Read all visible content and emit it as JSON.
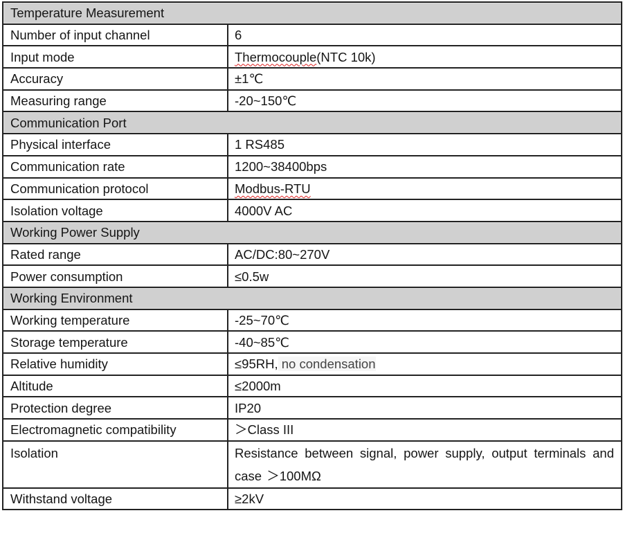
{
  "table": {
    "sections": [
      {
        "title": "Temperature Measurement",
        "rows": [
          {
            "label": "Number of input channel",
            "value": "6"
          },
          {
            "label": "Input mode",
            "value": "Thermocouple",
            "value_suffix": "(NTC 10k)",
            "spellcheck_flag": true
          },
          {
            "label": "Accuracy",
            "value": "±1℃"
          },
          {
            "label": "Measuring range",
            "value": "-20~150℃"
          }
        ]
      },
      {
        "title": "Communication Port",
        "rows": [
          {
            "label": "Physical interface",
            "value": "1 RS485"
          },
          {
            "label": "Communication rate",
            "value": "1200~38400bps"
          },
          {
            "label": "Communication protocol",
            "value": "Modbus-RTU",
            "spellcheck_flag": true
          },
          {
            "label": "Isolation voltage",
            "value": "4000V AC"
          }
        ]
      },
      {
        "title": "Working Power Supply",
        "rows": [
          {
            "label": "Rated range",
            "value": "AC/DC:80~270V"
          },
          {
            "label": "Power consumption",
            "value": "≤0.5w"
          }
        ]
      },
      {
        "title": "Working Environment",
        "rows": [
          {
            "label": "Working temperature",
            "value": "-25~70℃"
          },
          {
            "label": "Storage temperature",
            "value": "-40~85℃"
          },
          {
            "label": "Relative humidity",
            "value": "≤95RH,",
            "value_suffix": " no condensation"
          },
          {
            "label": "Altitude",
            "value": "≤2000m"
          },
          {
            "label": "Protection degree",
            "value": "IP20"
          },
          {
            "label": "Electromagnetic compatibility",
            "value": "＞Class III"
          },
          {
            "label": "Isolation",
            "value": "Resistance between signal, power supply, output terminals and case ＞100MΩ"
          },
          {
            "label": "Withstand voltage",
            "value": "≥2kV"
          }
        ]
      }
    ]
  },
  "colors": {
    "section_header_bg": "#d0d0d0",
    "border": "#222222",
    "text": "#151515",
    "spellcheck_underline": "#e02020"
  }
}
